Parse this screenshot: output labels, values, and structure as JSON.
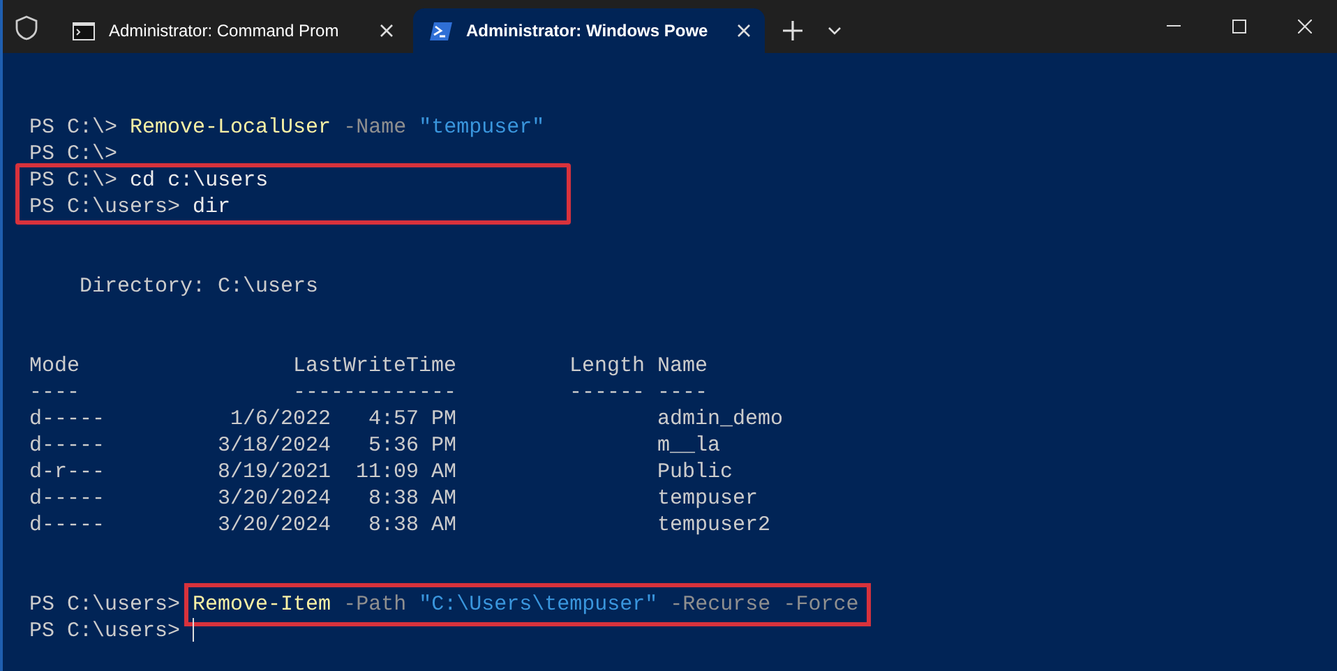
{
  "tabs": [
    {
      "kind": "cmd",
      "title": "Administrator: Command Prom",
      "selected": false
    },
    {
      "kind": "powershell",
      "title": "Administrator: Windows Powe",
      "selected": true
    }
  ],
  "console": [
    {
      "kind": "blank"
    },
    {
      "kind": "command",
      "prompt": "PS C:\\>",
      "parts": [
        {
          "kind": "cmdlet",
          "text": "Remove-LocalUser"
        },
        {
          "kind": "param",
          "text": "-Name"
        },
        {
          "kind": "string",
          "text": "\"tempuser\""
        }
      ]
    },
    {
      "kind": "command",
      "prompt": "PS C:\\>"
    },
    {
      "kind": "group",
      "highlighted": true,
      "lines": [
        {
          "kind": "command",
          "prompt": "PS C:\\>",
          "parts": [
            {
              "kind": "plain",
              "text": "cd"
            },
            {
              "kind": "plain",
              "text": "c:\\users"
            }
          ]
        },
        {
          "kind": "command",
          "prompt": "PS C:\\users>",
          "parts": [
            {
              "kind": "plain",
              "text": "dir"
            }
          ]
        }
      ]
    },
    {
      "kind": "blank"
    },
    {
      "kind": "blank"
    },
    {
      "kind": "output",
      "text": "Directory: C:\\users"
    },
    {
      "kind": "blank"
    },
    {
      "kind": "blank"
    },
    {
      "kind": "table",
      "header": [
        "Mode",
        "LastWriteTime",
        "Length",
        "Name"
      ],
      "rules": [
        "----",
        "-------------",
        "------",
        "----"
      ],
      "rows": [
        {
          "mode": "d-----",
          "date": "1/6/2022",
          "time": "4:57 PM",
          "name": "admin_demo"
        },
        {
          "mode": "d-----",
          "date": "3/18/2024",
          "time": "5:36 PM",
          "name": "m__la"
        },
        {
          "mode": "d-r---",
          "date": "8/19/2021",
          "time": "11:09 AM",
          "name": "Public"
        },
        {
          "mode": "d-----",
          "date": "3/20/2024",
          "time": "8:38 AM",
          "name": "tempuser"
        },
        {
          "mode": "d-----",
          "date": "3/20/2024",
          "time": "8:38 AM",
          "name": "tempuser2"
        }
      ]
    },
    {
      "kind": "blank"
    },
    {
      "kind": "blank"
    },
    {
      "kind": "command",
      "prompt": "PS C:\\users>",
      "command_highlighted": true,
      "parts": [
        {
          "kind": "cmdlet",
          "text": "Remove-Item"
        },
        {
          "kind": "param",
          "text": "-Path"
        },
        {
          "kind": "string",
          "text": "\"C:\\Users\\tempuser\""
        },
        {
          "kind": "param",
          "text": "-Recurse"
        },
        {
          "kind": "param",
          "text": "-Force"
        }
      ]
    },
    {
      "kind": "command",
      "prompt": "PS C:\\users>",
      "cursor": true
    }
  ]
}
